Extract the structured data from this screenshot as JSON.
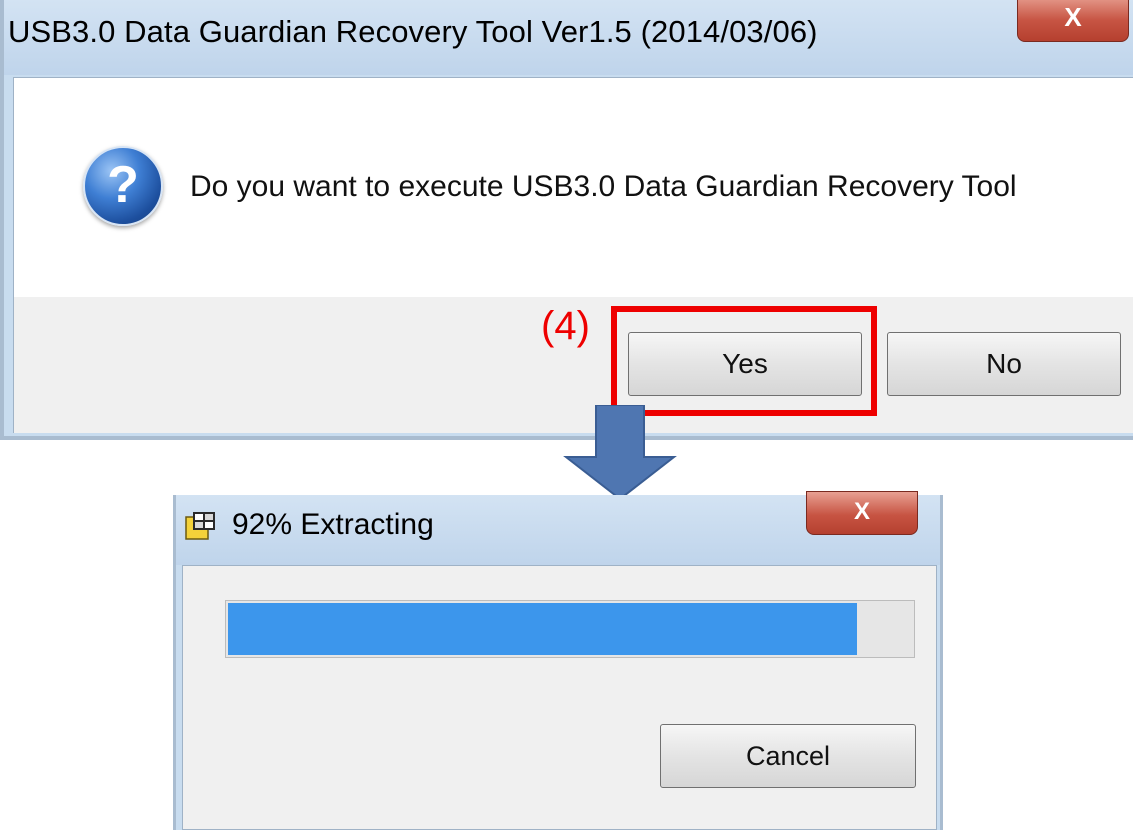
{
  "confirm_dialog": {
    "title": "USB3.0 Data Guardian Recovery Tool Ver1.5 (2014/03/06)",
    "message": "Do you want to execute USB3.0 Data Guardian Recovery Tool",
    "icon": "question-icon",
    "close_glyph": "X",
    "yes_label": "Yes",
    "no_label": "No"
  },
  "annotation": {
    "label": "(4)",
    "color": "#ee0000"
  },
  "arrow": {
    "color": "#4f76b1"
  },
  "progress_dialog": {
    "title": "92% Extracting",
    "icon": "installer-app-icon",
    "close_glyph": "X",
    "progress": 0.92,
    "progress_color": "#3c96ec",
    "cancel_label": "Cancel"
  }
}
